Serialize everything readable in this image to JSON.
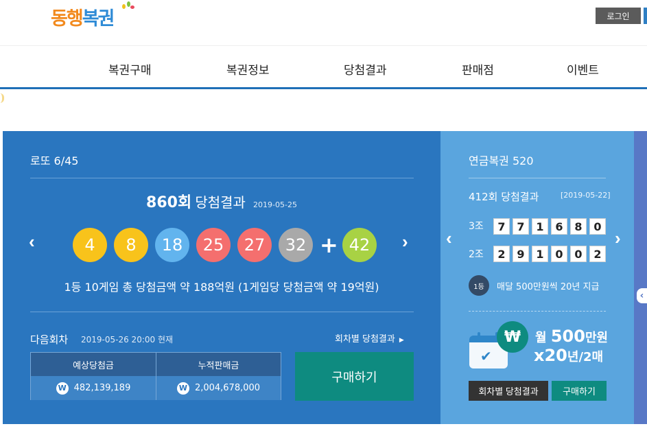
{
  "header": {
    "logo_text_orange": "동행",
    "logo_text_blue": "복권",
    "login_label": "로그인"
  },
  "nav": {
    "items": [
      "복권구매",
      "복권정보",
      "당첨결과",
      "판매점",
      "이벤트"
    ]
  },
  "lotto": {
    "title": "로또 6/45",
    "round_label": "860회",
    "result_label": "당첨결과",
    "draw_date": "2019-05-25",
    "numbers": [
      {
        "value": "4",
        "color": "#f8c31b"
      },
      {
        "value": "8",
        "color": "#f8c31b"
      },
      {
        "value": "18",
        "color": "#62b4ee"
      },
      {
        "value": "25",
        "color": "#f46f6e"
      },
      {
        "value": "27",
        "color": "#f46f6e"
      },
      {
        "value": "32",
        "color": "#a9a9a9"
      }
    ],
    "bonus": {
      "value": "42",
      "color": "#a8d244"
    },
    "plus": "+",
    "prize_summary": "1등 10게임 총 당첨금액 약 188억원 (1게임당 당첨금액 약 19억원)",
    "next_label": "다음회차",
    "next_date": "2019-05-26 20:00 현재",
    "round_result_link": "회차별 당첨결과",
    "expected_prize_label": "예상당첨금",
    "expected_prize_value": "482,139,189",
    "total_sales_label": "누적판매금",
    "total_sales_value": "2,004,678,000",
    "won_symbol": "W",
    "buy_label": "구매하기",
    "prev_arrow": "‹",
    "next_arrow": "›"
  },
  "pension": {
    "title": "연금복권 520",
    "round_label": "412회 당첨결과",
    "draw_date": "[2019-05-22]",
    "rows": [
      {
        "label": "3조",
        "digits": [
          "7",
          "7",
          "1",
          "6",
          "8",
          "0"
        ]
      },
      {
        "label": "2조",
        "digits": [
          "2",
          "9",
          "1",
          "0",
          "0",
          "2"
        ]
      }
    ],
    "badge": "1등",
    "note": "매달 500만원씩 20년 지급",
    "won_symbol": "₩",
    "promo_line1_a": "월",
    "promo_line1_b": "500",
    "promo_line1_c": "만원",
    "promo_line2_a": "x20",
    "promo_line2_b": "년/2매",
    "round_result_button": "회차별 당첨결과",
    "buy_button": "구매하기",
    "prev_arrow": "‹",
    "next_arrow": "›",
    "edge_arrow": "‹"
  }
}
